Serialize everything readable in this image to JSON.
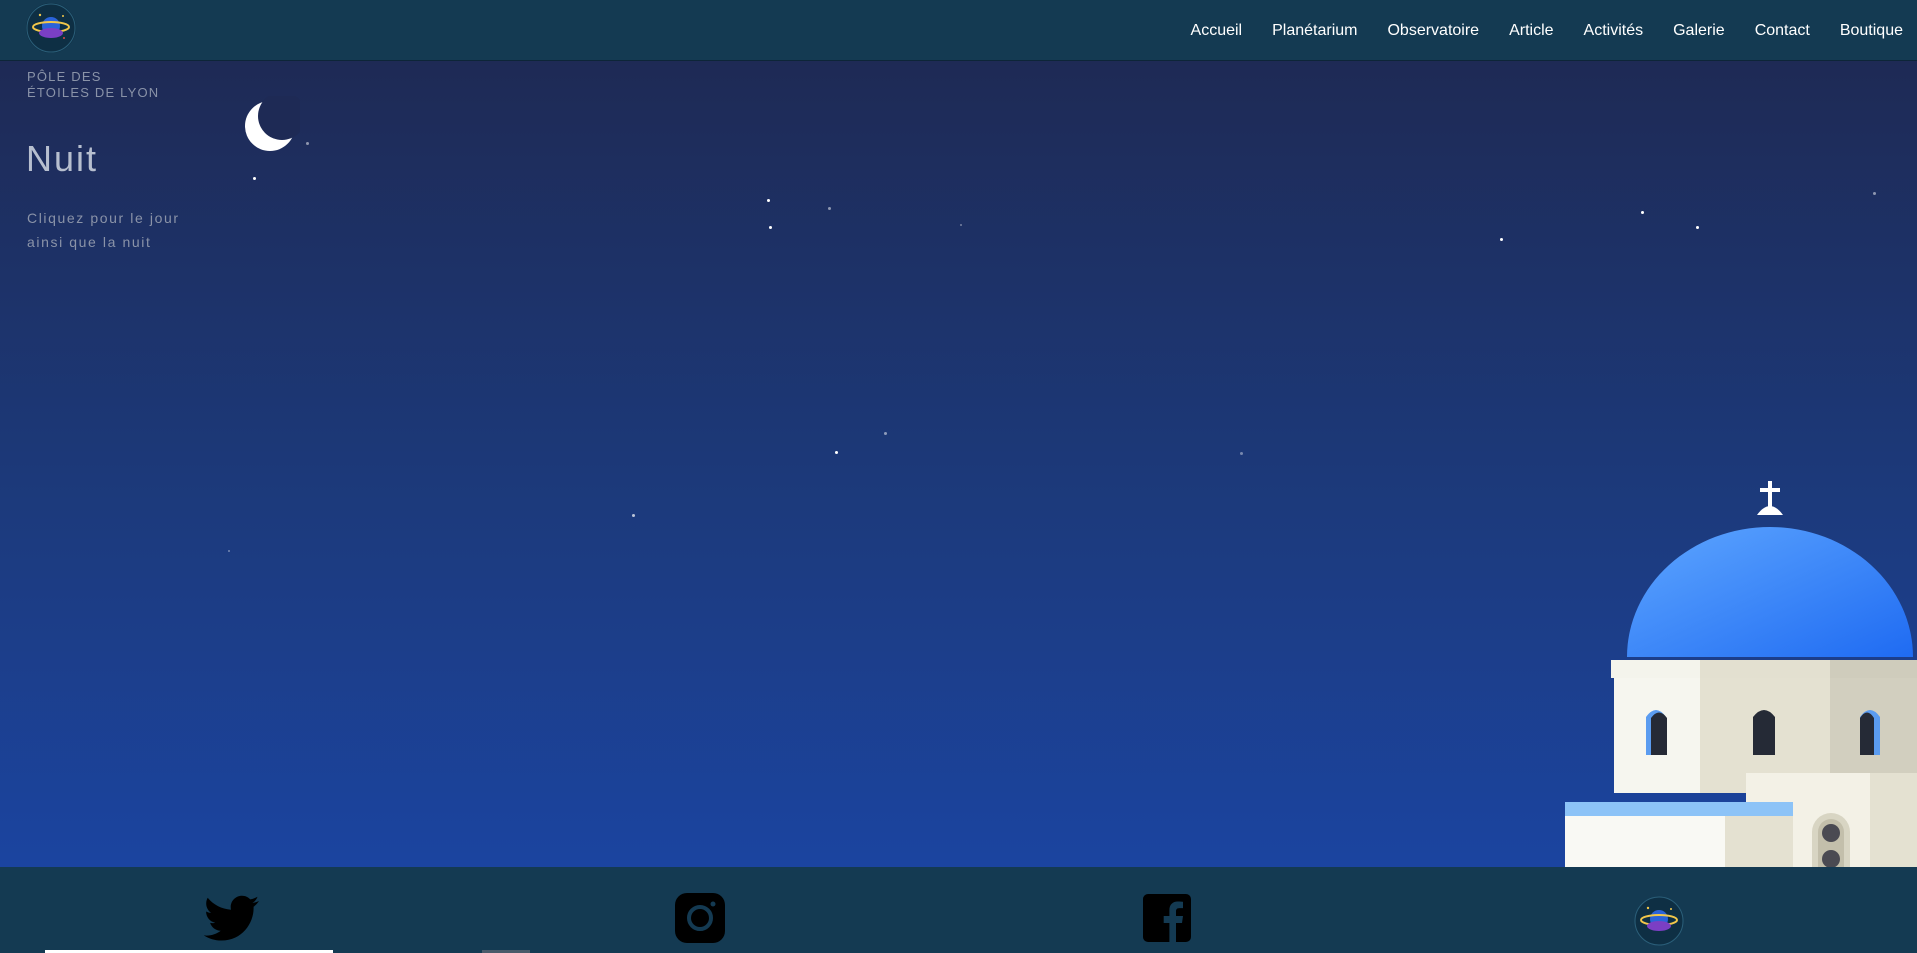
{
  "nav": {
    "logo_icon": "planet-logo-icon",
    "links": [
      "Accueil",
      "Planétarium",
      "Observatoire",
      "Article",
      "Activités",
      "Galerie",
      "Contact",
      "Boutique"
    ]
  },
  "hero": {
    "brand_line1": "Pôle des",
    "brand_line2": "Étoiles de Lyon",
    "mode_title": "Nuit",
    "mode_hint": "Cliquez pour le jour ainsi que la nuit",
    "toggle_icon": "moon-icon",
    "scene": "night-sky-with-blue-dome-church"
  },
  "footer": {
    "social_icons": [
      "twitter-icon",
      "instagram-icon",
      "facebook-icon",
      "planet-logo-icon"
    ]
  },
  "colors": {
    "nav_bg": "#143a52",
    "sky_top": "#1e2a55",
    "sky_bottom": "#1b44a0",
    "dome_blue": "#2f7cf5",
    "church_white": "#f6f6ef"
  }
}
